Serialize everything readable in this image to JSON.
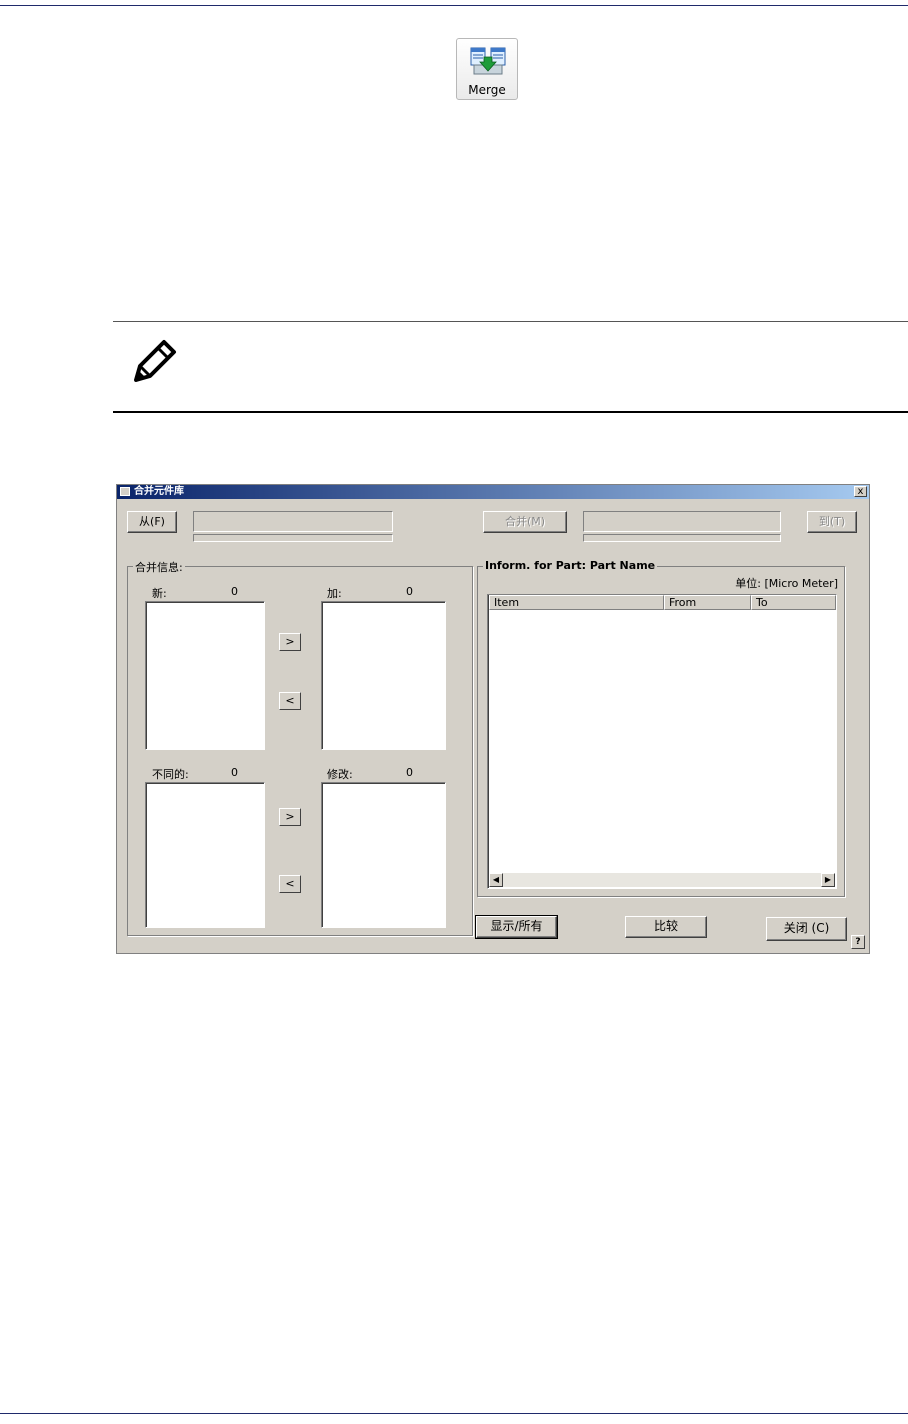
{
  "toolbar": {
    "merge_label": "Merge"
  },
  "dialog": {
    "title": "合并元件库",
    "close_glyph": "x",
    "help_glyph": "?",
    "from_button": "从(F)",
    "merge_button": "合并(M)",
    "to_button": "到(T)",
    "merge_info": {
      "group_label": "合并信息:",
      "new_label": "新:",
      "new_count": "0",
      "add_label": "加:",
      "add_count": "0",
      "diff_label": "不同的:",
      "diff_count": "0",
      "modify_label": "修改:",
      "modify_count": "0",
      "move_right": ">",
      "move_left": "<"
    },
    "part_info": {
      "group_label": "Inform. for Part: Part Name",
      "unit_label": "单位: [Micro Meter]",
      "columns": [
        "Item",
        "From",
        "To"
      ]
    },
    "show_all_button": "显示/所有",
    "compare_button": "比较",
    "close_button": "关闭 (C)"
  }
}
